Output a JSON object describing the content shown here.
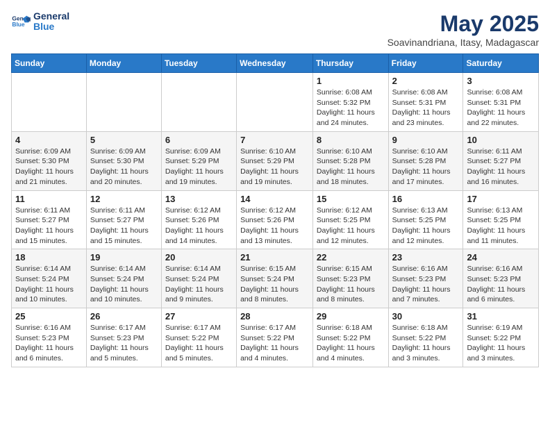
{
  "logo": {
    "line1": "General",
    "line2": "Blue"
  },
  "title": "May 2025",
  "subtitle": "Soavinandriana, Itasy, Madagascar",
  "weekdays": [
    "Sunday",
    "Monday",
    "Tuesday",
    "Wednesday",
    "Thursday",
    "Friday",
    "Saturday"
  ],
  "weeks": [
    [
      {
        "day": "",
        "info": ""
      },
      {
        "day": "",
        "info": ""
      },
      {
        "day": "",
        "info": ""
      },
      {
        "day": "",
        "info": ""
      },
      {
        "day": "1",
        "info": "Sunrise: 6:08 AM\nSunset: 5:32 PM\nDaylight: 11 hours and 24 minutes."
      },
      {
        "day": "2",
        "info": "Sunrise: 6:08 AM\nSunset: 5:31 PM\nDaylight: 11 hours and 23 minutes."
      },
      {
        "day": "3",
        "info": "Sunrise: 6:08 AM\nSunset: 5:31 PM\nDaylight: 11 hours and 22 minutes."
      }
    ],
    [
      {
        "day": "4",
        "info": "Sunrise: 6:09 AM\nSunset: 5:30 PM\nDaylight: 11 hours and 21 minutes."
      },
      {
        "day": "5",
        "info": "Sunrise: 6:09 AM\nSunset: 5:30 PM\nDaylight: 11 hours and 20 minutes."
      },
      {
        "day": "6",
        "info": "Sunrise: 6:09 AM\nSunset: 5:29 PM\nDaylight: 11 hours and 19 minutes."
      },
      {
        "day": "7",
        "info": "Sunrise: 6:10 AM\nSunset: 5:29 PM\nDaylight: 11 hours and 19 minutes."
      },
      {
        "day": "8",
        "info": "Sunrise: 6:10 AM\nSunset: 5:28 PM\nDaylight: 11 hours and 18 minutes."
      },
      {
        "day": "9",
        "info": "Sunrise: 6:10 AM\nSunset: 5:28 PM\nDaylight: 11 hours and 17 minutes."
      },
      {
        "day": "10",
        "info": "Sunrise: 6:11 AM\nSunset: 5:27 PM\nDaylight: 11 hours and 16 minutes."
      }
    ],
    [
      {
        "day": "11",
        "info": "Sunrise: 6:11 AM\nSunset: 5:27 PM\nDaylight: 11 hours and 15 minutes."
      },
      {
        "day": "12",
        "info": "Sunrise: 6:11 AM\nSunset: 5:27 PM\nDaylight: 11 hours and 15 minutes."
      },
      {
        "day": "13",
        "info": "Sunrise: 6:12 AM\nSunset: 5:26 PM\nDaylight: 11 hours and 14 minutes."
      },
      {
        "day": "14",
        "info": "Sunrise: 6:12 AM\nSunset: 5:26 PM\nDaylight: 11 hours and 13 minutes."
      },
      {
        "day": "15",
        "info": "Sunrise: 6:12 AM\nSunset: 5:25 PM\nDaylight: 11 hours and 12 minutes."
      },
      {
        "day": "16",
        "info": "Sunrise: 6:13 AM\nSunset: 5:25 PM\nDaylight: 11 hours and 12 minutes."
      },
      {
        "day": "17",
        "info": "Sunrise: 6:13 AM\nSunset: 5:25 PM\nDaylight: 11 hours and 11 minutes."
      }
    ],
    [
      {
        "day": "18",
        "info": "Sunrise: 6:14 AM\nSunset: 5:24 PM\nDaylight: 11 hours and 10 minutes."
      },
      {
        "day": "19",
        "info": "Sunrise: 6:14 AM\nSunset: 5:24 PM\nDaylight: 11 hours and 10 minutes."
      },
      {
        "day": "20",
        "info": "Sunrise: 6:14 AM\nSunset: 5:24 PM\nDaylight: 11 hours and 9 minutes."
      },
      {
        "day": "21",
        "info": "Sunrise: 6:15 AM\nSunset: 5:24 PM\nDaylight: 11 hours and 8 minutes."
      },
      {
        "day": "22",
        "info": "Sunrise: 6:15 AM\nSunset: 5:23 PM\nDaylight: 11 hours and 8 minutes."
      },
      {
        "day": "23",
        "info": "Sunrise: 6:16 AM\nSunset: 5:23 PM\nDaylight: 11 hours and 7 minutes."
      },
      {
        "day": "24",
        "info": "Sunrise: 6:16 AM\nSunset: 5:23 PM\nDaylight: 11 hours and 6 minutes."
      }
    ],
    [
      {
        "day": "25",
        "info": "Sunrise: 6:16 AM\nSunset: 5:23 PM\nDaylight: 11 hours and 6 minutes."
      },
      {
        "day": "26",
        "info": "Sunrise: 6:17 AM\nSunset: 5:23 PM\nDaylight: 11 hours and 5 minutes."
      },
      {
        "day": "27",
        "info": "Sunrise: 6:17 AM\nSunset: 5:22 PM\nDaylight: 11 hours and 5 minutes."
      },
      {
        "day": "28",
        "info": "Sunrise: 6:17 AM\nSunset: 5:22 PM\nDaylight: 11 hours and 4 minutes."
      },
      {
        "day": "29",
        "info": "Sunrise: 6:18 AM\nSunset: 5:22 PM\nDaylight: 11 hours and 4 minutes."
      },
      {
        "day": "30",
        "info": "Sunrise: 6:18 AM\nSunset: 5:22 PM\nDaylight: 11 hours and 3 minutes."
      },
      {
        "day": "31",
        "info": "Sunrise: 6:19 AM\nSunset: 5:22 PM\nDaylight: 11 hours and 3 minutes."
      }
    ]
  ]
}
